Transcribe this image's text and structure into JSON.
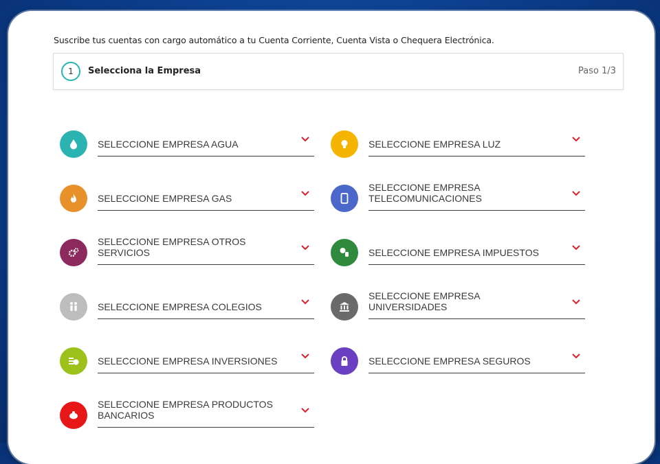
{
  "intro_text": "Suscribe tus cuentas con cargo automático a tu Cuenta Corriente, Cuenta Vista o Chequera Electrónica.",
  "step": {
    "number": "1",
    "title": "Selecciona la Empresa",
    "paso": "Paso 1/3"
  },
  "selectors": [
    {
      "label": "SELECCIONE EMPRESA AGUA",
      "icon": "water-drop-icon",
      "color": "#2bb3b1"
    },
    {
      "label": "SELECCIONE EMPRESA LUZ",
      "icon": "lightbulb-icon",
      "color": "#f5b400"
    },
    {
      "label": "SELECCIONE EMPRESA GAS",
      "icon": "flame-icon",
      "color": "#e8912a"
    },
    {
      "label": "SELECCIONE EMPRESA TELECOMUNICACIONES",
      "icon": "mobile-phone-icon",
      "color": "#4a67c9"
    },
    {
      "label": "SELECCIONE EMPRESA OTROS SERVICIOS",
      "icon": "gears-icon",
      "color": "#8c2a5e"
    },
    {
      "label": "SELECCIONE EMPRESA IMPUESTOS",
      "icon": "tax-money-icon",
      "color": "#2f8a3e"
    },
    {
      "label": "SELECCIONE EMPRESA COLEGIOS",
      "icon": "students-icon",
      "color": "#bdbdbd"
    },
    {
      "label": "SELECCIONE EMPRESA UNIVERSIDADES",
      "icon": "university-building-icon",
      "color": "#6a6a6a"
    },
    {
      "label": "SELECCIONE EMPRESA INVERSIONES",
      "icon": "coins-icon",
      "color": "#9cc11a"
    },
    {
      "label": "SELECCIONE EMPRESA SEGUROS",
      "icon": "padlock-icon",
      "color": "#6a3fc2"
    },
    {
      "label": "SELECCIONE EMPRESA PRODUCTOS BANCARIOS",
      "icon": "piggy-bank-icon",
      "color": "#e81717"
    }
  ],
  "chevron_color": "#d9212b"
}
